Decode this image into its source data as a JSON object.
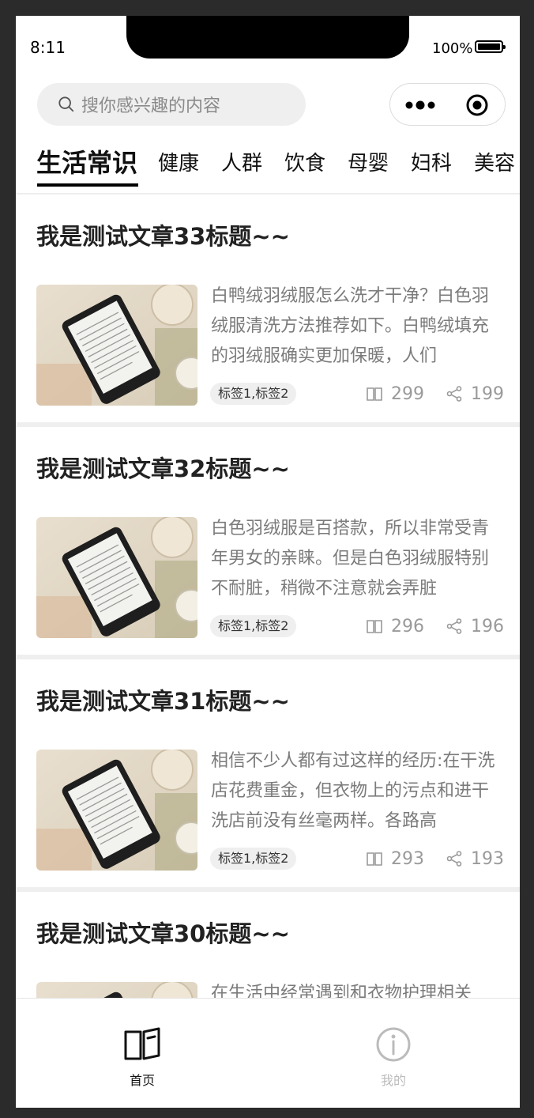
{
  "status_bar": {
    "time": "8:11",
    "battery": "100%"
  },
  "search": {
    "placeholder": "搜你感兴趣的内容"
  },
  "tabs": [
    "生活常识",
    "健康",
    "人群",
    "饮食",
    "母婴",
    "妇科",
    "美容"
  ],
  "active_tab": 0,
  "articles": [
    {
      "title": "我是测试文章33标题~~",
      "summary": "白鸭绒羽绒服怎么洗才干净？白色羽绒服清洗方法推荐如下。白鸭绒填充的羽绒服确实更加保暖，人们",
      "tags": "标签1,标签2",
      "reads": "299",
      "shares": "199"
    },
    {
      "title": "我是测试文章32标题~~",
      "summary": "白色羽绒服是百搭款，所以非常受青年男女的亲睐。但是白色羽绒服特别不耐脏，稍微不注意就会弄脏",
      "tags": "标签1,标签2",
      "reads": "296",
      "shares": "196"
    },
    {
      "title": "我是测试文章31标题~~",
      "summary": "相信不少人都有过这样的经历:在干洗店花费重金，但衣物上的污点和进干洗店前没有丝毫两样。各路高",
      "tags": "标签1,标签2",
      "reads": "293",
      "shares": "193"
    },
    {
      "title": "我是测试文章30标题~~",
      "summary": "在生活中经常遇到和衣物护理相关",
      "tags": "",
      "reads": "",
      "shares": ""
    }
  ],
  "tabbar": [
    {
      "label": "首页",
      "icon": "book-icon",
      "active": true
    },
    {
      "label": "我的",
      "icon": "info-icon",
      "active": false
    }
  ],
  "colors": {
    "accent": "#000000",
    "inactive": "#bbbbbb",
    "muted_text": "#7b7b7b",
    "background": "#efefef"
  }
}
